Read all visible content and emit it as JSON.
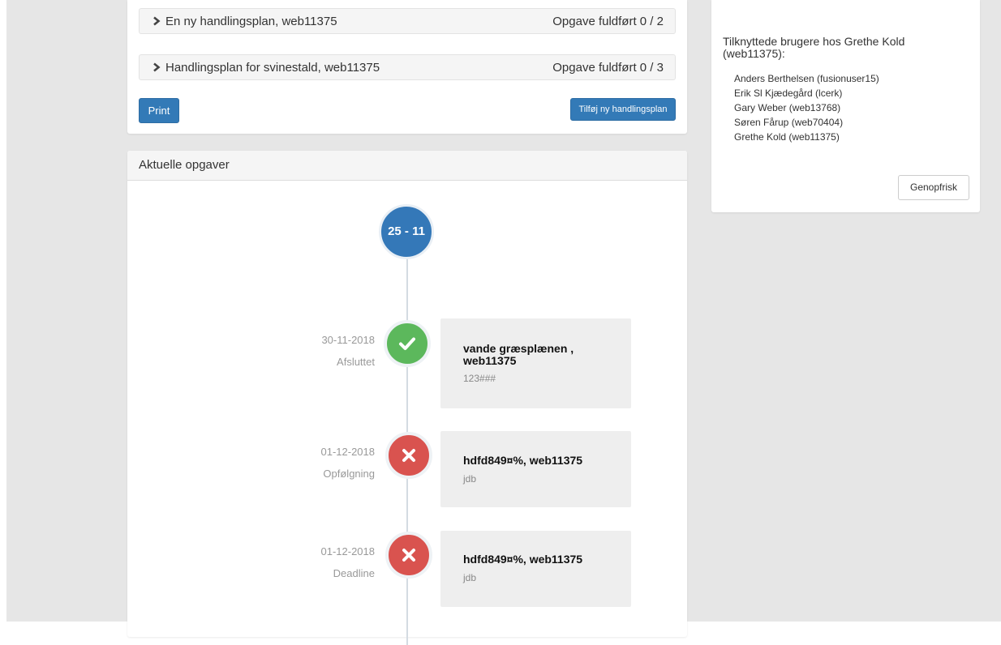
{
  "action_plans": {
    "rows": [
      {
        "title": "En ny handlingsplan, web11375",
        "progress": "Opgave fuldført 0 / 2"
      },
      {
        "title": "Handlingsplan for svinestald, web11375",
        "progress": "Opgave fuldført 0 / 3"
      }
    ],
    "print_label": "Print",
    "add_label": "Tilføj ny handlingsplan"
  },
  "tasks_panel": {
    "heading": "Aktuelle opgaver",
    "date_marker": "25 - 11",
    "entries": [
      {
        "date": "30-11-2018",
        "status": "Afsluttet",
        "state": "done",
        "title": "vande græsplænen , web11375",
        "sub": "123###"
      },
      {
        "date": "01-12-2018",
        "status": "Opfølgning",
        "state": "failed",
        "title": "hdfd849¤%, web11375",
        "sub": "jdb"
      },
      {
        "date": "01-12-2018",
        "status": "Deadline",
        "state": "failed",
        "title": "hdfd849¤%, web11375",
        "sub": "jdb"
      }
    ]
  },
  "users_panel": {
    "title": "Tilknyttede brugere hos Grethe Kold (web11375):",
    "users": [
      "Anders Berthelsen (fusionuser15)",
      "Erik Sl Kjædegård (lcerk)",
      "Gary Weber (web13768)",
      "Søren Fårup (web70404)",
      "Grethe Kold (web11375)"
    ],
    "refresh_label": "Genopfrisk"
  },
  "colors": {
    "primary": "#337ab7",
    "success": "#5cb85c",
    "danger": "#d9534f",
    "date_marker": "#3478b8"
  },
  "icons": {
    "chevron": "chevron-right-icon",
    "done": "check-icon",
    "failed": "close-icon"
  }
}
